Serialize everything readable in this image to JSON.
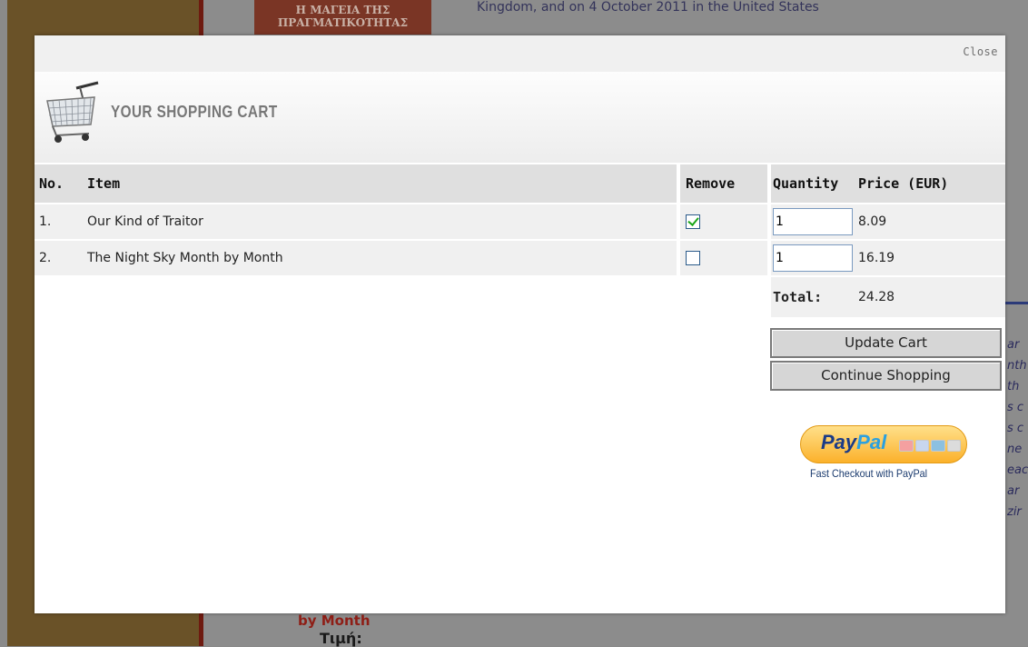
{
  "background": {
    "book_cover_lines": [
      "Η ΜΑΓΕΙΑ ΤΗΣ",
      "ΠΡΑΓΜΑΤΙΚΟΤΗΤΑΣ"
    ],
    "top_text": "Kingdom, and on 4 October 2011 in the United States",
    "side_fragments": [
      "ar",
      "nth",
      "th",
      "s c",
      "s c",
      "ne",
      "eac",
      "ar",
      "zir"
    ],
    "bottom_title": "by Month",
    "bottom_sub": "Τιμή:"
  },
  "modal": {
    "close_label": "Close",
    "title": "YOUR SHOPPING CART",
    "columns": {
      "no": "No.",
      "item": "Item",
      "remove": "Remove",
      "quantity": "Quantity",
      "price": "Price (EUR)"
    },
    "rows": [
      {
        "no": "1.",
        "item": "Our Kind of Traitor",
        "remove": true,
        "quantity": "1",
        "price": "8.09"
      },
      {
        "no": "2.",
        "item": "The Night Sky Month by Month",
        "remove": false,
        "quantity": "1",
        "price": "16.19"
      }
    ],
    "total_label": "Total:",
    "total_value": "24.28",
    "update_button": "Update Cart",
    "continue_button": "Continue Shopping",
    "paypal": {
      "logo_pay": "Pay",
      "logo_pal": "Pal",
      "caption": "Fast Checkout with PayPal"
    }
  }
}
